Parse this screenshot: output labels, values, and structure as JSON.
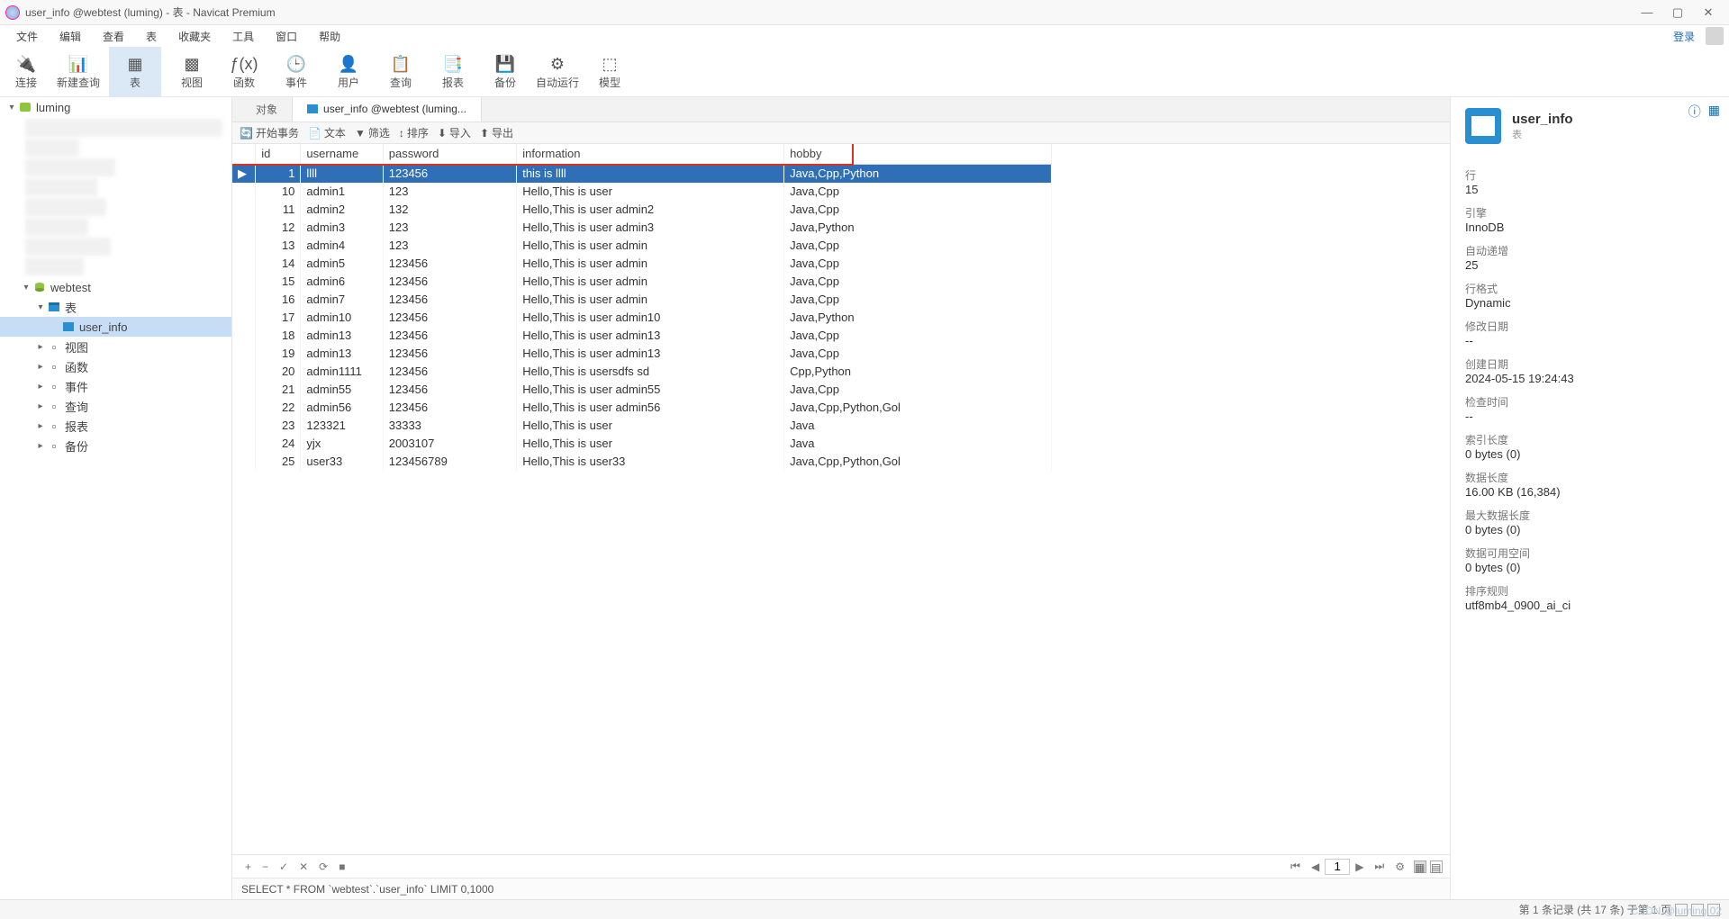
{
  "title": "user_info @webtest (luming) - 表 - Navicat Premium",
  "menubar": [
    "文件",
    "编辑",
    "查看",
    "表",
    "收藏夹",
    "工具",
    "窗口",
    "帮助"
  ],
  "login_label": "登录",
  "toolbar": [
    {
      "label": "连接",
      "icon": "plug"
    },
    {
      "label": "新建查询",
      "icon": "query"
    },
    {
      "label": "表",
      "icon": "table",
      "active": true
    },
    {
      "label": "视图",
      "icon": "view"
    },
    {
      "label": "函数",
      "icon": "fx"
    },
    {
      "label": "事件",
      "icon": "clock"
    },
    {
      "label": "用户",
      "icon": "user"
    },
    {
      "label": "查询",
      "icon": "sheet"
    },
    {
      "label": "报表",
      "icon": "report"
    },
    {
      "label": "备份",
      "icon": "backup"
    },
    {
      "label": "自动运行",
      "icon": "auto"
    },
    {
      "label": "模型",
      "icon": "model"
    }
  ],
  "tree": {
    "conn": "luming",
    "db": "webtest",
    "node_table": "表",
    "active_table": "user_info",
    "subs": [
      "视图",
      "函数",
      "事件",
      "查询",
      "报表",
      "备份"
    ]
  },
  "tabs": {
    "object": "对象",
    "active": "user_info @webtest (luming..."
  },
  "tblbar": {
    "begin": "开始事务",
    "text": "文本",
    "filter": "筛选",
    "sort": "排序",
    "import": "导入",
    "export": "导出"
  },
  "columns": [
    "id",
    "username",
    "password",
    "information",
    "hobby"
  ],
  "rows": [
    {
      "id": "1",
      "username": "llll",
      "password": "123456",
      "information": "this is llll",
      "hobby": "Java,Cpp,Python",
      "sel": true
    },
    {
      "id": "10",
      "username": "admin1",
      "password": "123",
      "information": "Hello,This is user",
      "hobby": "Java,Cpp"
    },
    {
      "id": "11",
      "username": "admin2",
      "password": "132",
      "information": "Hello,This is user admin2",
      "hobby": "Java,Cpp"
    },
    {
      "id": "12",
      "username": "admin3",
      "password": "123",
      "information": "Hello,This is user admin3",
      "hobby": "Java,Python"
    },
    {
      "id": "13",
      "username": "admin4",
      "password": "123",
      "information": "Hello,This is user admin",
      "hobby": "Java,Cpp"
    },
    {
      "id": "14",
      "username": "admin5",
      "password": "123456",
      "information": "Hello,This is user admin",
      "hobby": "Java,Cpp"
    },
    {
      "id": "15",
      "username": "admin6",
      "password": "123456",
      "information": "Hello,This is user admin",
      "hobby": "Java,Cpp"
    },
    {
      "id": "16",
      "username": "admin7",
      "password": "123456",
      "information": "Hello,This is user admin",
      "hobby": "Java,Cpp"
    },
    {
      "id": "17",
      "username": "admin10",
      "password": "123456",
      "information": "Hello,This is user admin10",
      "hobby": "Java,Python"
    },
    {
      "id": "18",
      "username": "admin13",
      "password": "123456",
      "information": "Hello,This is user admin13",
      "hobby": "Java,Cpp"
    },
    {
      "id": "19",
      "username": "admin13",
      "password": "123456",
      "information": "Hello,This is user admin13",
      "hobby": "Java,Cpp"
    },
    {
      "id": "20",
      "username": "admin1111",
      "password": "123456",
      "information": "Hello,This is usersdfs sd",
      "hobby": "Cpp,Python"
    },
    {
      "id": "21",
      "username": "admin55",
      "password": "123456",
      "information": "Hello,This is user admin55",
      "hobby": "Java,Cpp"
    },
    {
      "id": "22",
      "username": "admin56",
      "password": "123456",
      "information": "Hello,This is user admin56",
      "hobby": "Java,Cpp,Python,Gol"
    },
    {
      "id": "23",
      "username": "123321",
      "password": "33333",
      "information": "Hello,This is user",
      "hobby": "Java"
    },
    {
      "id": "24",
      "username": "yjx",
      "password": "2003107",
      "information": "Hello,This is user",
      "hobby": "Java"
    },
    {
      "id": "25",
      "username": "user33",
      "password": "123456789",
      "information": "Hello,This is user33",
      "hobby": "Java,Cpp,Python,Gol"
    }
  ],
  "footer": {
    "page_input": "1"
  },
  "sql": "SELECT * FROM `webtest`.`user_info` LIMIT 0,1000",
  "right": {
    "title": "user_info",
    "subtype": "表",
    "props": [
      {
        "k": "行",
        "v": "15"
      },
      {
        "k": "引擎",
        "v": "InnoDB"
      },
      {
        "k": "自动递增",
        "v": "25"
      },
      {
        "k": "行格式",
        "v": "Dynamic"
      },
      {
        "k": "修改日期",
        "v": "--"
      },
      {
        "k": "创建日期",
        "v": "2024-05-15 19:24:43"
      },
      {
        "k": "检查时间",
        "v": "--"
      },
      {
        "k": "索引长度",
        "v": "0 bytes (0)"
      },
      {
        "k": "数据长度",
        "v": "16.00 KB (16,384)"
      },
      {
        "k": "最大数据长度",
        "v": "0 bytes (0)"
      },
      {
        "k": "数据可用空间",
        "v": "0 bytes (0)"
      },
      {
        "k": "排序规则",
        "v": "utf8mb4_0900_ai_ci"
      }
    ]
  },
  "status": "第 1 条记录 (共 17 条) 于第 1 页",
  "watermark": "CSDN @luming.02"
}
